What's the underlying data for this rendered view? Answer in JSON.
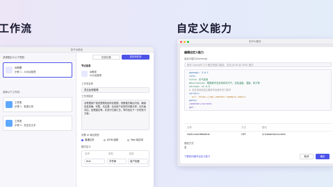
{
  "left": {
    "heading_partial": "工作流",
    "window_title": "扣子AI助手",
    "intent_label": "或调整定义以下意图：",
    "intent_card": {
      "name": "AI助理",
      "desc": "步骤 1：AI对话整理"
    },
    "workflow_hint": "选择以下工作流：",
    "wf_items": [
      {
        "name": "工作流",
        "desc": "步骤 1：数据记录"
      },
      {
        "name": "工作流",
        "desc": "步骤 2：发送至文本"
      }
    ],
    "header_buttons": {
      "history": "历史记录",
      "publish": "发布到任务"
    },
    "detail": {
      "section": "节点信息",
      "node_name": "AI助手",
      "node_sub": "AI对话整理",
      "config_label": "工作流名称",
      "config_value": "意见反馈整理",
      "prompt_label": "工作流描述",
      "prompt_text": "请根据用户描述整理成结构化数据，按照格式输出内容，确保信息准确、完整、无遗漏，包含用户反馈的问题分类、优先级评估、处理建议等，并进行归纳汇总，同时给出下一步的执行方案。",
      "output_label": "设置 AI 输出类型",
      "output_options": [
        "普通文本",
        "JSON 结构",
        "Text 纯文本"
      ],
      "table_label": "格式定义",
      "table_headers": [
        "名称",
        "类型",
        "描述"
      ],
      "table_rows": [
        [
          "title",
          "字符串",
          "用户标题"
        ]
      ]
    }
  },
  "right": {
    "heading": "自定义能力",
    "window_title": "扣子AI助手",
    "dialog_title": "编辑自定义能力",
    "schema_label": "自定义能力(Schema)",
    "schema_hint": "填写 OpenAPI 3.0 格式的接口描述，支持 JSON 或 YAML 格式",
    "code": [
      "openapi: 3.0.1",
      "info:",
      "  title: 天气查询",
      "  description: 根据城市名查询实时天气，包括温度、湿度、风力等",
      "  version: v1.0.0",
      "  # 支持查询全国主要城市及海外热门城市",
      "servers:",
      "  - url: https://api.weather.example.com/v1",
      "paths:",
      "  /weather/current:",
      "    get:"
    ],
    "table_headers": [
      "名称",
      "方法",
      "路径"
    ],
    "table_row": {
      "name": "GetCurrentWeather",
      "method": "GET",
      "path": "/v1/weather/current"
    },
    "auth_label": "授权方式",
    "auth_value": "无",
    "footer_link": "了解如何编写自定义能力",
    "cancel": "取消",
    "confirm": "确定"
  },
  "colors": {
    "accent": "#4d53e8",
    "dot_red": "#ff5f57",
    "dot_yellow": "#febc2e",
    "dot_green": "#28c840"
  }
}
